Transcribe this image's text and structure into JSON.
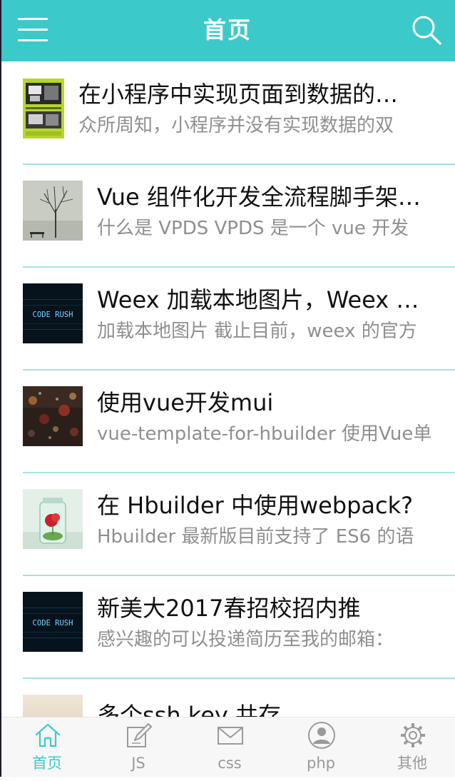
{
  "header": {
    "title": "首页",
    "background": "#3cc9c9",
    "left_icon": "menu-icon",
    "right_icon": "search-icon"
  },
  "articles": [
    {
      "title": "在小程序中实现页面到数据的…",
      "desc": "众所周知，小程序并没有实现数据的双",
      "thumb": "book-cover-thumbnail"
    },
    {
      "title": "Vue 组件化开发全流程脚手架…",
      "desc": "什么是 VPDS VPDS 是一个 vue 开发",
      "thumb": "bare-tree-thumbnail"
    },
    {
      "title": "Weex 加载本地图片，Weex …",
      "desc": "加载本地图片 截止目前，weex 的官方",
      "thumb": "code-rush-thumbnail",
      "thumb_text": "CODE RUSH"
    },
    {
      "title": "使用vue开发mui",
      "desc": "vue-template-for-hbuilder 使用Vue单",
      "thumb": "rainy-window-thumbnail"
    },
    {
      "title": "在 Hbuilder 中使用webpack?",
      "desc": "Hbuilder 最新版目前支持了 ES6 的语",
      "thumb": "flower-jar-thumbnail"
    },
    {
      "title": "新美大2017春招校招内推",
      "desc": "感兴趣的可以投递简历至我的邮箱：",
      "thumb": "code-rush-thumbnail",
      "thumb_text": "CODE RUSH"
    },
    {
      "title": "多个ssh key 共存",
      "desc": "",
      "thumb": "sky-thumbnail"
    }
  ],
  "tabs": [
    {
      "label": "首页",
      "icon": "home-icon",
      "active": true
    },
    {
      "label": "JS",
      "icon": "edit-icon",
      "active": false
    },
    {
      "label": "css",
      "icon": "mail-icon",
      "active": false
    },
    {
      "label": "php",
      "icon": "user-icon",
      "active": false
    },
    {
      "label": "其他",
      "icon": "gear-icon",
      "active": false
    }
  ],
  "colors": {
    "accent": "#3cc9c9",
    "separator": "#a6e2e0",
    "tab_inactive": "#9a9a9a",
    "description": "#8f8f8f"
  }
}
